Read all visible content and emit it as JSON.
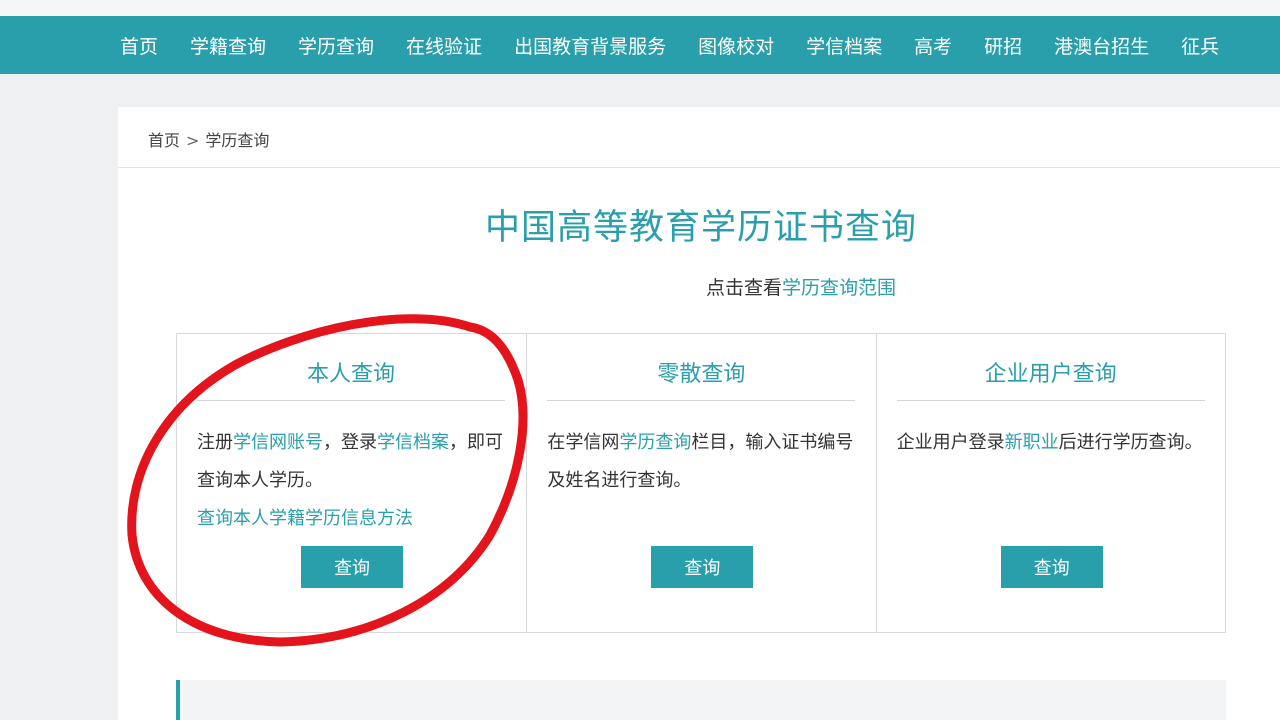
{
  "nav": {
    "items": [
      "首页",
      "学籍查询",
      "学历查询",
      "在线验证",
      "出国教育背景服务",
      "图像校对",
      "学信档案",
      "高考",
      "研招",
      "港澳台招生",
      "征兵"
    ]
  },
  "breadcrumb": {
    "home": "首页",
    "separator": ">",
    "current": "学历查询"
  },
  "main": {
    "title": "中国高等教育学历证书查询",
    "subline_prefix": "点击查看",
    "subline_link": "学历查询范围"
  },
  "options": [
    {
      "title": "本人查询",
      "body": [
        {
          "text": "注册",
          "link": false
        },
        {
          "text": "学信网账号",
          "link": true
        },
        {
          "text": "，登录",
          "link": false
        },
        {
          "text": "学信档案",
          "link": true
        },
        {
          "text": "，即可查询本人学历。",
          "link": false
        }
      ],
      "extra_link": "查询本人学籍学历信息方法",
      "button": "查询"
    },
    {
      "title": "零散查询",
      "body": [
        {
          "text": "在学信网",
          "link": false
        },
        {
          "text": "学历查询",
          "link": true
        },
        {
          "text": "栏目，输入证书编号及姓名进行查询。",
          "link": false
        }
      ],
      "extra_link": "",
      "button": "查询"
    },
    {
      "title": "企业用户查询",
      "body": [
        {
          "text": "企业用户登录",
          "link": false
        },
        {
          "text": "新职业",
          "link": true
        },
        {
          "text": "后进行学历查询。",
          "link": false
        }
      ],
      "extra_link": "",
      "button": "查询"
    }
  ],
  "colors": {
    "accent": "#2a9fac",
    "annotation": "#e3141b"
  }
}
